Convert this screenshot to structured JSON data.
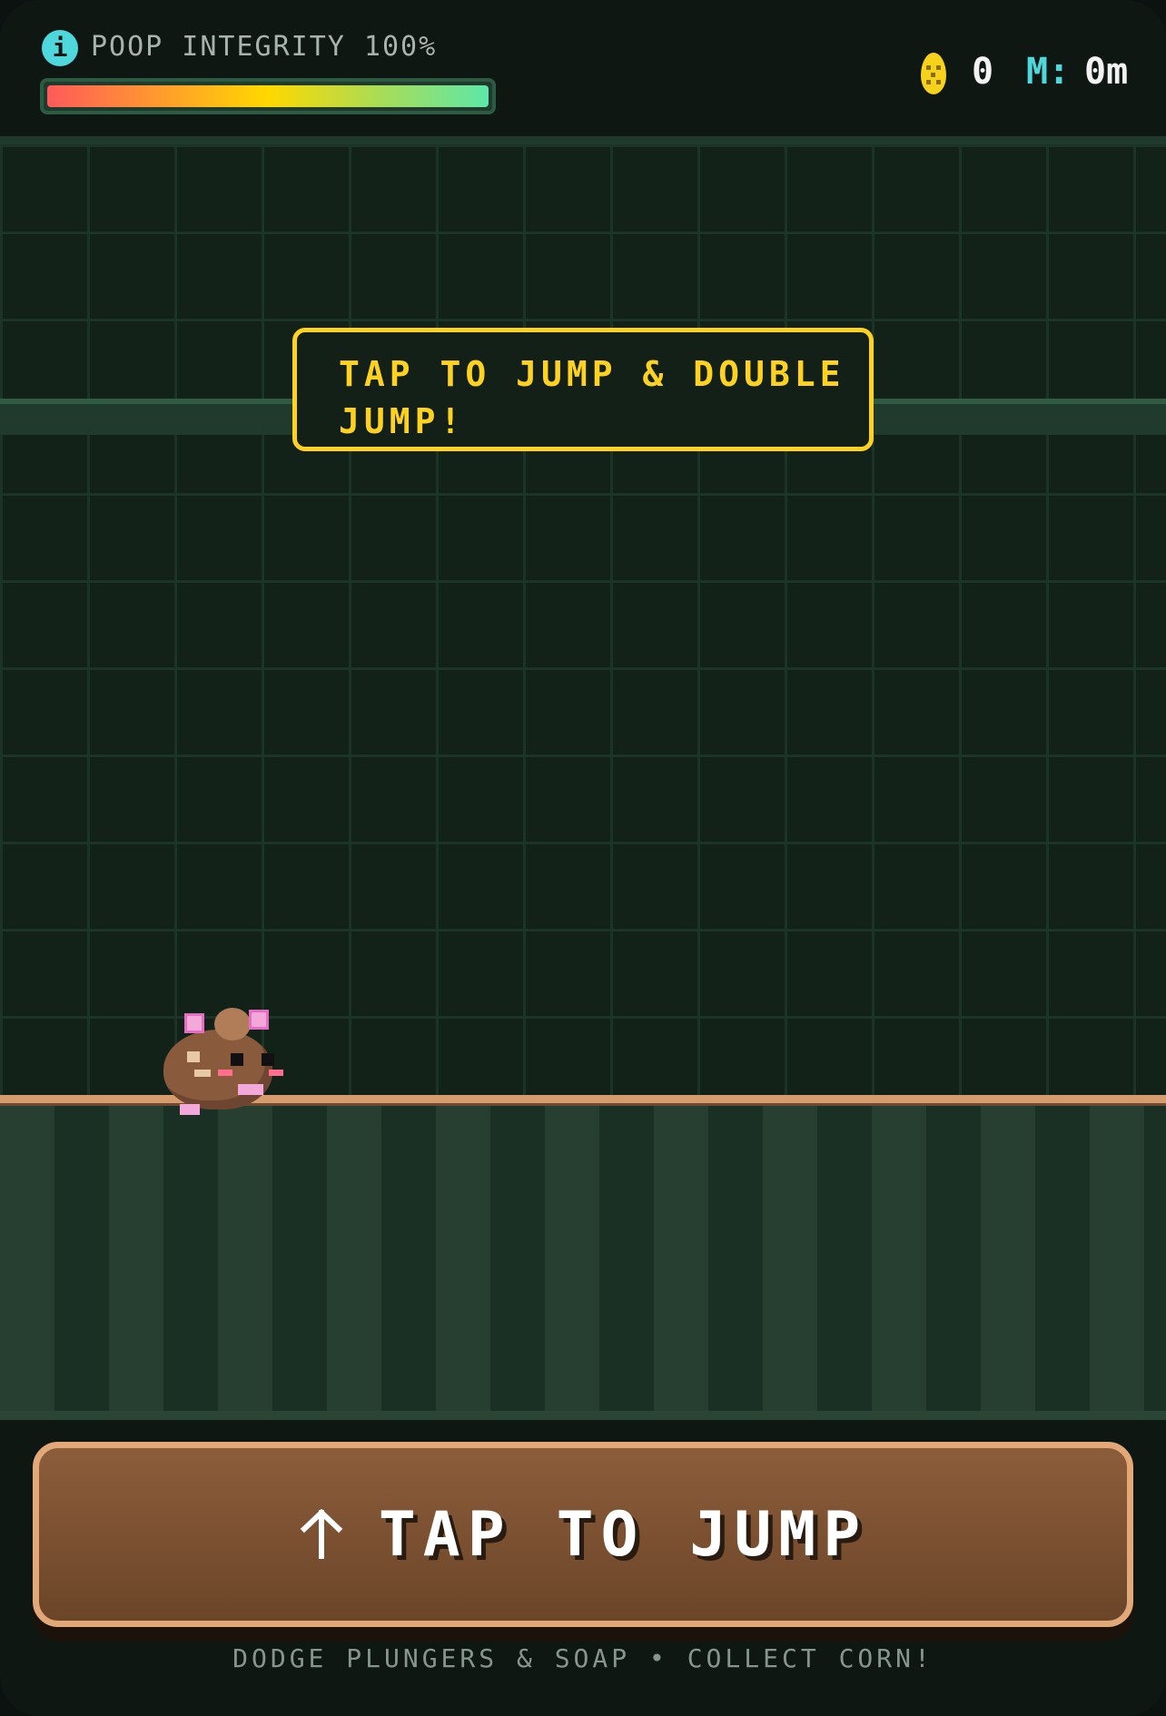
{
  "hud": {
    "info_icon_glyph": "i",
    "integrity_label": "POOP INTEGRITY 100%",
    "integrity_value": 1.0,
    "corn_count": "0",
    "distance_label": "M:",
    "distance_value": "0m"
  },
  "hint": {
    "text": "TAP TO JUMP & DOUBLE JUMP!"
  },
  "controls": {
    "jump_label": "TAP TO JUMP"
  },
  "footer": {
    "text": "DODGE PLUNGERS & SOAP • COLLECT CORN!"
  },
  "icons": {
    "info": "info-icon",
    "corn": "corn-icon",
    "arrow": "arrow-up-icon"
  },
  "colors": {
    "accent_cyan": "#4fd8dc",
    "hint_yellow": "#ffd21f",
    "button_brown": "#7a4f31",
    "button_border": "#e3a878"
  }
}
